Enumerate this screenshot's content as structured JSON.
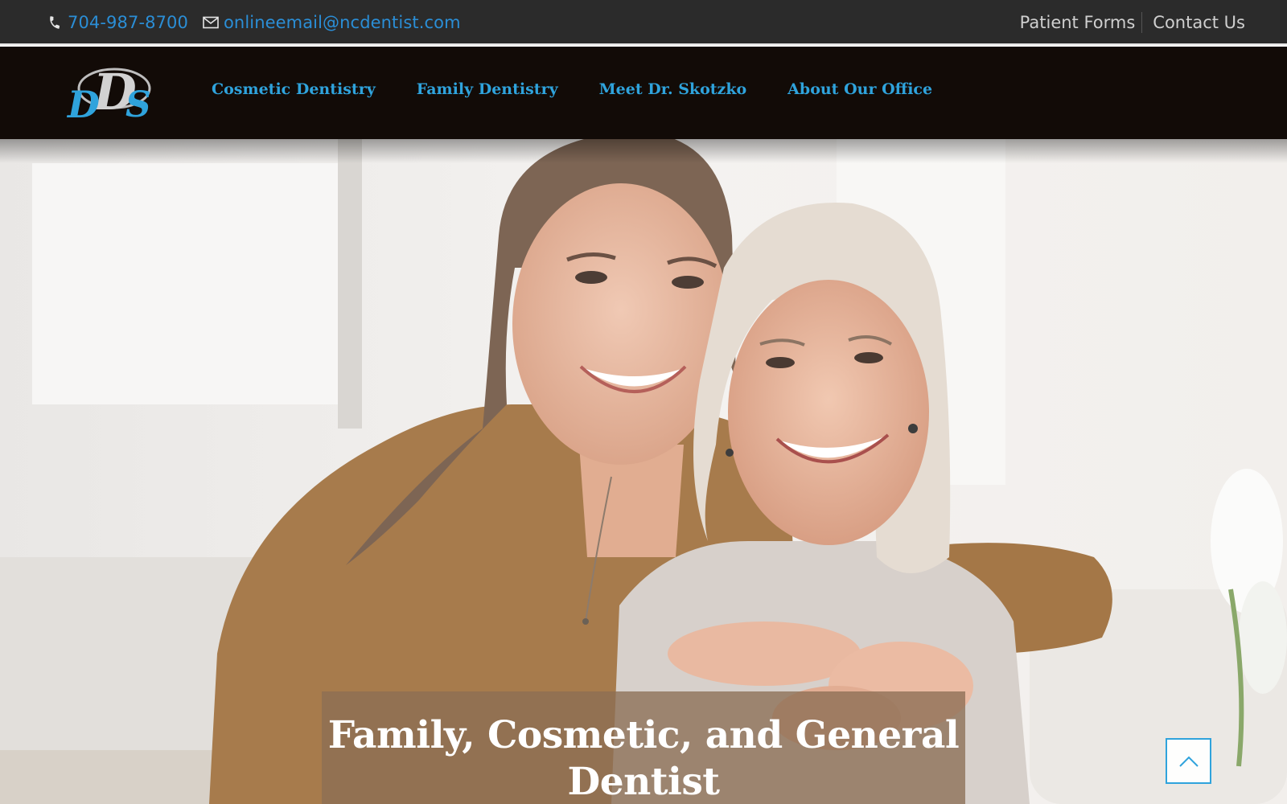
{
  "topbar": {
    "phone": "704-987-8700",
    "email": "onlineemail@ncdentist.com",
    "links": [
      "Patient Forms",
      "Contact Us"
    ]
  },
  "nav": {
    "logo_text": "DDS",
    "items": [
      "Cosmetic Dentistry",
      "Family Dentistry",
      "Meet Dr. Skotzko",
      "About Our Office"
    ]
  },
  "hero": {
    "headline": "Family, Cosmetic, and General Dentist",
    "image_alt": "Two smiling women embracing"
  },
  "colors": {
    "accent": "#2fa3dc",
    "topbar_bg": "#2b2b2b",
    "navbar_bg": "#120b07",
    "caption_bg": "#8c6e54"
  },
  "icons": {
    "phone": "phone-icon",
    "email": "envelope-icon",
    "to_top": "chevron-up-icon"
  }
}
